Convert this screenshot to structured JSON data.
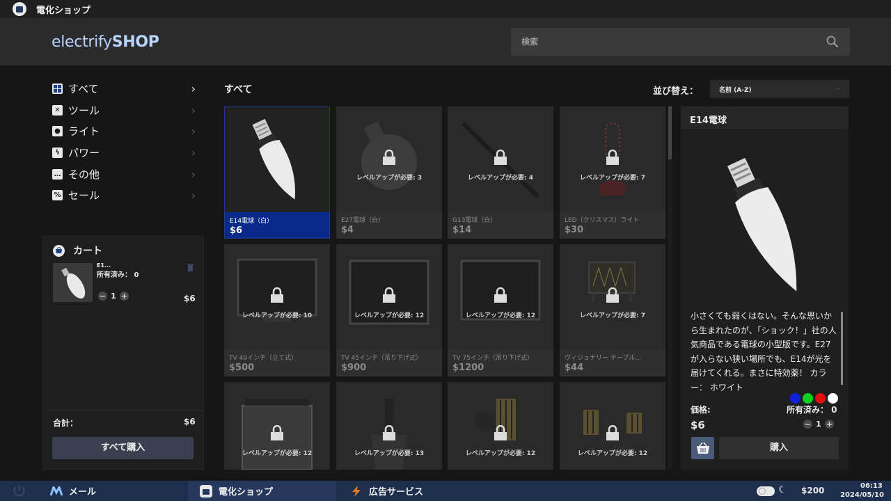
{
  "window": {
    "title": "電化ショップ"
  },
  "header": {
    "logo_light": "electrify",
    "logo_bold": "SHOP",
    "search_placeholder": "検索"
  },
  "sidebar": {
    "categories": [
      {
        "label": "すべて",
        "icon": "grid-icon"
      },
      {
        "label": "ツール",
        "icon": "tools-icon"
      },
      {
        "label": "ライト",
        "icon": "bulb-icon"
      },
      {
        "label": "パワー",
        "icon": "bolt-icon"
      },
      {
        "label": "その他",
        "icon": "dots-icon"
      },
      {
        "label": "セール",
        "icon": "percent-icon"
      }
    ]
  },
  "cart": {
    "title": "カート",
    "item": {
      "name": "E1...",
      "owned": "所有済み： 0",
      "qty": "1",
      "price": "$6"
    },
    "total_label": "合計：",
    "total_value": "$6",
    "buy_all": "すべて購入"
  },
  "grid": {
    "title": "すべて",
    "sort_label": "並び替え：",
    "sort_value": "名前 (A-Z)",
    "products": [
      {
        "name": "E14電球（白）",
        "price": "$6",
        "lock": ""
      },
      {
        "name": "E27電球（白）",
        "price": "$4",
        "lock": "レベルアップが必要: 3"
      },
      {
        "name": "G13電球（白）",
        "price": "$14",
        "lock": "レベルアップが必要: 4"
      },
      {
        "name": "LED（クリスマス）ライト",
        "price": "$30",
        "lock": "レベルアップが必要: 7"
      },
      {
        "name": "TV 40インチ（立て式）",
        "price": "$500",
        "lock": "レベルアップが必要: 10"
      },
      {
        "name": "TV 45インチ（吊り下げ式）",
        "price": "$900",
        "lock": "レベルアップが必要: 12"
      },
      {
        "name": "TV 75インチ（吊り下げ式）",
        "price": "$1200",
        "lock": "レベルアップが必要: 12"
      },
      {
        "name": "ヴィジョナリー テーブル...",
        "price": "$44",
        "lock": "レベルアップが必要: 7"
      },
      {
        "lock": "レベルアップが必要: 12"
      },
      {
        "lock": "レベルアップが必要: 13"
      },
      {
        "lock": "レベルアップが必要: 12"
      },
      {
        "lock": "レベルアップが必要: 12"
      }
    ]
  },
  "detail": {
    "title": "E14電球",
    "description": "小さくても弱くはない。そんな思いから生まれたのが、「ショック！」社の人気商品である電球の小型版です。E27が入らない狭い場所でも、E14が光を届けてくれる。まさに特効薬！ カラー： ホワイト",
    "colors": [
      "#1020e0",
      "#10d020",
      "#e01010",
      "#ffffff"
    ],
    "price_label": "価格:",
    "price": "$6",
    "owned": "所有済み： 0",
    "qty": "1",
    "buy": "購入"
  },
  "taskbar": {
    "apps": [
      {
        "label": "メール"
      },
      {
        "label": "電化ショップ"
      },
      {
        "label": "広告サービス"
      }
    ],
    "money": "$200",
    "time": "06:13",
    "date": "2024/05/10"
  }
}
